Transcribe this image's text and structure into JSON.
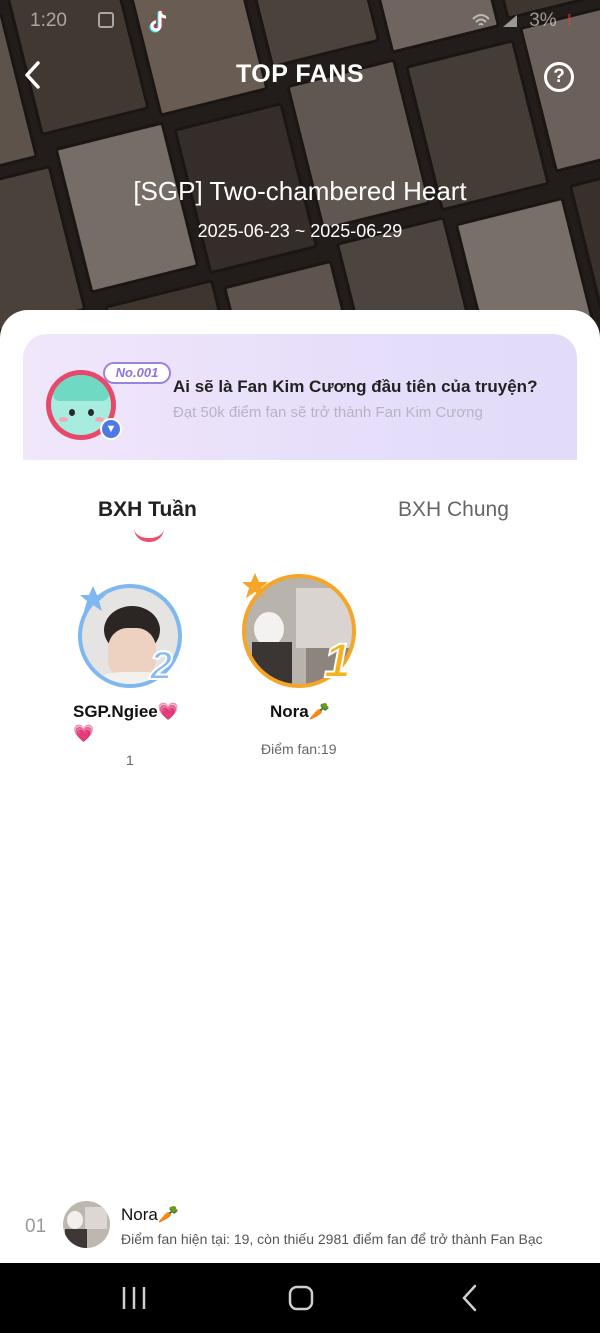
{
  "statusbar": {
    "time": "1:20",
    "battery": "3%",
    "battery_alert": "!"
  },
  "header": {
    "title": "TOP FANS",
    "help_label": "?"
  },
  "story": {
    "title": "[SGP] Two-chambered Heart",
    "date_range": "2025-06-23 ~ 2025-06-29"
  },
  "banner": {
    "badge": "No.001",
    "title": "Ai sẽ là Fan Kim Cương đầu tiên của truyện?",
    "subtitle": "Đạt 50k điểm fan sẽ trở thành Fan Kim Cương"
  },
  "tabs": [
    {
      "label": "BXH Tuần",
      "active": true
    },
    {
      "label": "BXH Chung",
      "active": false
    }
  ],
  "podium": [
    {
      "rank": "2",
      "name": "SGP.Ngiee💗",
      "name_line2": "💗",
      "score": "1"
    },
    {
      "rank": "1",
      "name": "Nora🥕",
      "score": "Điểm fan:19"
    }
  ],
  "my_rank": {
    "rank": "01",
    "name": "Nora🥕",
    "description": "Điểm fan hiện tại: 19, còn thiếu 2981 điểm fan để trở thành Fan Bạc"
  },
  "colors": {
    "accent_pink": "#ef4f6e",
    "rank1_gold": "#f5a629",
    "rank2_blue": "#7fb7f0",
    "banner_purple": "#e6defa"
  }
}
